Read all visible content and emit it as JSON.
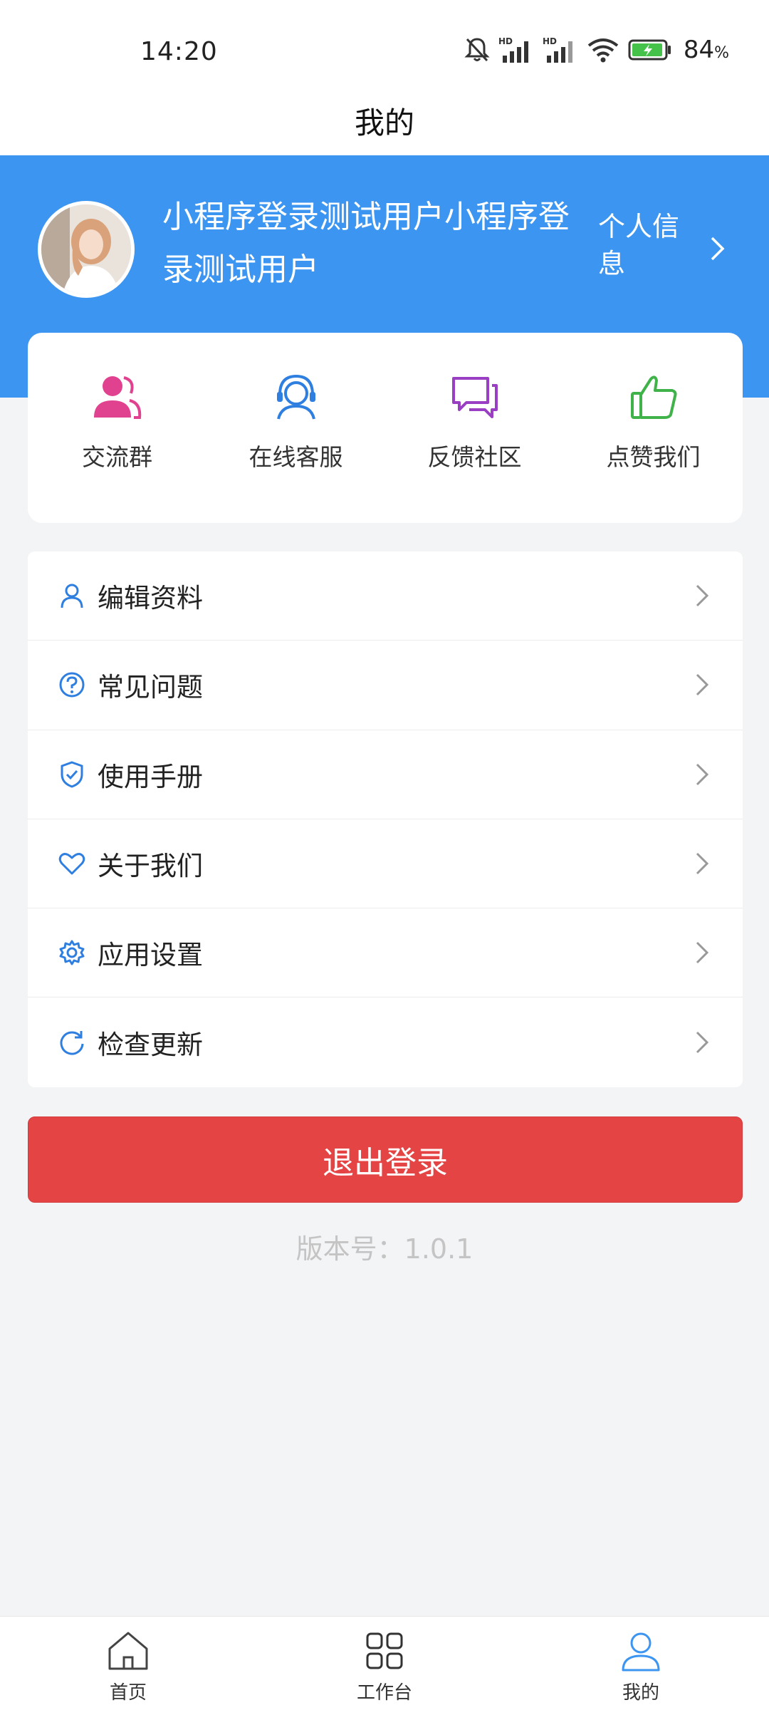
{
  "status_bar": {
    "time": "14:20",
    "battery": "84",
    "battery_unit": "%"
  },
  "nav": {
    "title": "我的"
  },
  "profile": {
    "username": "小程序登录测试用户小程序登录测试用户",
    "info_link": "个人信息"
  },
  "quick_actions": [
    {
      "label": "交流群",
      "icon": "users-icon",
      "color": "#e0428f"
    },
    {
      "label": "在线客服",
      "icon": "headset-icon",
      "color": "#2f7fe0"
    },
    {
      "label": "反馈社区",
      "icon": "chat-bubbles-icon",
      "color": "#9a3fc4"
    },
    {
      "label": "点赞我们",
      "icon": "thumbs-up-icon",
      "color": "#3fb24a"
    }
  ],
  "menu": [
    {
      "label": "编辑资料",
      "icon": "user-icon"
    },
    {
      "label": "常见问题",
      "icon": "question-icon"
    },
    {
      "label": "使用手册",
      "icon": "shield-icon"
    },
    {
      "label": "关于我们",
      "icon": "heart-icon"
    },
    {
      "label": "应用设置",
      "icon": "gear-icon"
    },
    {
      "label": "检查更新",
      "icon": "refresh-icon"
    }
  ],
  "logout": {
    "label": "退出登录"
  },
  "version": {
    "text": "版本号：1.0.1"
  },
  "tabs": [
    {
      "label": "首页",
      "icon": "home-icon"
    },
    {
      "label": "工作台",
      "icon": "grid-icon"
    },
    {
      "label": "我的",
      "icon": "user-icon",
      "active": true
    }
  ],
  "colors": {
    "primary": "#3d95f2",
    "danger": "#e54445",
    "menu_icon": "#2f7fe0",
    "active_tab": "#3d95f2"
  }
}
